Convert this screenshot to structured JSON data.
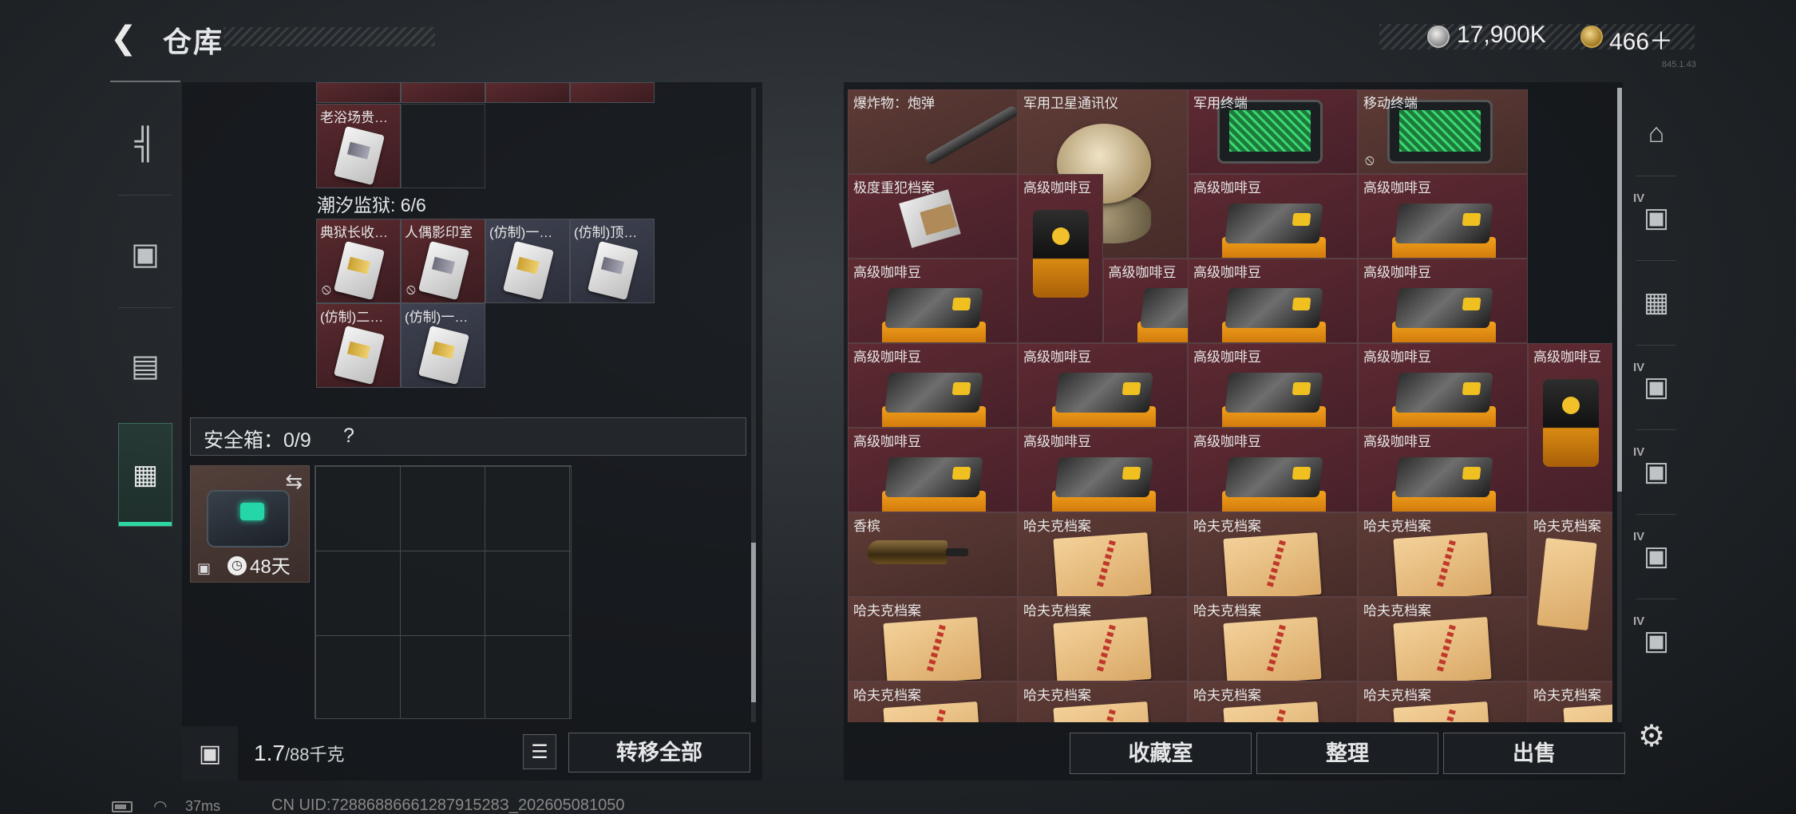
{
  "header": {
    "back_icon": "chevron-left-icon",
    "title": "仓库",
    "currency1_icon": "coin-silver-icon",
    "currency1_value": "17,900K",
    "currency2_icon": "coin-gold-icon",
    "currency2_value": "466＋",
    "version": "845.1.43"
  },
  "left_nav": {
    "items": [
      {
        "icon": "pistol-icon",
        "glyph": "╤"
      },
      {
        "icon": "backpack-icon",
        "glyph": "⌂"
      },
      {
        "icon": "vest-icon",
        "glyph": "▤"
      },
      {
        "icon": "toolbox-icon",
        "glyph": "⛶",
        "active": true
      }
    ]
  },
  "left_panel": {
    "top_item": {
      "label": "老浴场贵…"
    },
    "prison_section": {
      "title": "潮汐监狱: 6/6",
      "items": [
        {
          "label": "典狱长收…",
          "style": "red",
          "card": "gold",
          "locked": true
        },
        {
          "label": "人偶影印室",
          "style": "red",
          "card": "silver",
          "locked": true
        },
        {
          "label": "(仿制)一…",
          "style": "gray",
          "card": "gold",
          "locked": false
        },
        {
          "label": "(仿制)顶…",
          "style": "gray",
          "card": "silver",
          "locked": false
        },
        {
          "label": "(仿制)二…",
          "style": "red",
          "card": "gold",
          "locked": false
        },
        {
          "label": "(仿制)一…",
          "style": "gray",
          "card": "gold",
          "locked": false
        }
      ]
    },
    "safe": {
      "title": "安全箱：0/9",
      "help": "?",
      "duration": "48天",
      "swap_icon": "swap-icon",
      "clock_icon": "clock-icon",
      "lock_icon": "lock-icon"
    },
    "footer": {
      "lock_icon": "lock-icon",
      "weight_value": "1.7",
      "weight_unit": "/88千克",
      "list_icon": "list-icon",
      "transfer_label": "转移全部"
    }
  },
  "stash": {
    "items": [
      {
        "label": "爆炸物：炮弹",
        "type": "missile",
        "style": "tan",
        "col": 0,
        "row": 0,
        "w": 2,
        "h": 1
      },
      {
        "label": "军用卫星通讯仪",
        "type": "dish",
        "style": "tan",
        "col": 2,
        "row": 0,
        "w": 2,
        "h": 2
      },
      {
        "label": "军用终端",
        "type": "terminal",
        "style": "red",
        "col": 4,
        "row": 0,
        "w": 2,
        "h": 1
      },
      {
        "label": "移动终端",
        "type": "terminal",
        "style": "tan",
        "col": 6,
        "row": 0,
        "w": 2,
        "h": 1,
        "locked": true
      },
      {
        "label": "极度重犯档案",
        "type": "doc",
        "style": "red",
        "col": 0,
        "row": 1,
        "w": 2,
        "h": 1
      },
      {
        "label": "高级咖啡豆",
        "type": "coffee-tall",
        "style": "red",
        "col": 2,
        "row": 1,
        "w": 1,
        "h": 2
      },
      {
        "label": "高级咖啡豆",
        "type": "coffee",
        "style": "red",
        "col": 4,
        "row": 1,
        "w": 2,
        "h": 1
      },
      {
        "label": "高级咖啡豆",
        "type": "coffee",
        "style": "red",
        "col": 6,
        "row": 1,
        "w": 2,
        "h": 1
      },
      {
        "label": "高级咖啡豆",
        "type": "coffee",
        "style": "red",
        "col": 0,
        "row": 2,
        "w": 2,
        "h": 1
      },
      {
        "label": "高级咖啡豆",
        "type": "coffee",
        "style": "red",
        "col": 3,
        "row": 2,
        "w": 2,
        "h": 1
      },
      {
        "label": "高级咖啡豆",
        "type": "coffee",
        "style": "red",
        "col": 4,
        "row": 2,
        "w": 2,
        "h": 1
      },
      {
        "label": "高级咖啡豆",
        "type": "coffee",
        "style": "red",
        "col": 6,
        "row": 2,
        "w": 2,
        "h": 1
      },
      {
        "label": "高级咖啡豆",
        "type": "coffee",
        "style": "red",
        "col": 0,
        "row": 3,
        "w": 2,
        "h": 1
      },
      {
        "label": "高级咖啡豆",
        "type": "coffee",
        "style": "red",
        "col": 2,
        "row": 3,
        "w": 2,
        "h": 1
      },
      {
        "label": "高级咖啡豆",
        "type": "coffee",
        "style": "red",
        "col": 4,
        "row": 3,
        "w": 2,
        "h": 1
      },
      {
        "label": "高级咖啡豆",
        "type": "coffee",
        "style": "red",
        "col": 6,
        "row": 3,
        "w": 2,
        "h": 1
      },
      {
        "label": "高级咖啡豆",
        "type": "coffee-tall",
        "style": "red",
        "col": 8,
        "row": 3,
        "w": 1,
        "h": 2
      },
      {
        "label": "高级咖啡豆",
        "type": "coffee",
        "style": "red",
        "col": 0,
        "row": 4,
        "w": 2,
        "h": 1
      },
      {
        "label": "高级咖啡豆",
        "type": "coffee",
        "style": "red",
        "col": 2,
        "row": 4,
        "w": 2,
        "h": 1
      },
      {
        "label": "高级咖啡豆",
        "type": "coffee",
        "style": "red",
        "col": 4,
        "row": 4,
        "w": 2,
        "h": 1
      },
      {
        "label": "高级咖啡豆",
        "type": "coffee",
        "style": "red",
        "col": 6,
        "row": 4,
        "w": 2,
        "h": 1
      },
      {
        "label": "香槟",
        "type": "bottle",
        "style": "tan",
        "col": 0,
        "row": 5,
        "w": 2,
        "h": 1
      },
      {
        "label": "哈夫克档案",
        "type": "folder",
        "style": "tan",
        "col": 2,
        "row": 5,
        "w": 2,
        "h": 1
      },
      {
        "label": "哈夫克档案",
        "type": "folder",
        "style": "tan",
        "col": 4,
        "row": 5,
        "w": 2,
        "h": 1
      },
      {
        "label": "哈夫克档案",
        "type": "folder",
        "style": "tan",
        "col": 6,
        "row": 5,
        "w": 2,
        "h": 1
      },
      {
        "label": "哈夫克档案",
        "type": "folder-tall",
        "style": "tan",
        "col": 8,
        "row": 5,
        "w": 1,
        "h": 2
      },
      {
        "label": "哈夫克档案",
        "type": "folder",
        "style": "tan",
        "col": 0,
        "row": 6,
        "w": 2,
        "h": 1
      },
      {
        "label": "哈夫克档案",
        "type": "folder",
        "style": "tan",
        "col": 2,
        "row": 6,
        "w": 2,
        "h": 1
      },
      {
        "label": "哈夫克档案",
        "type": "folder",
        "style": "tan",
        "col": 4,
        "row": 6,
        "w": 2,
        "h": 1
      },
      {
        "label": "哈夫克档案",
        "type": "folder",
        "style": "tan",
        "col": 6,
        "row": 6,
        "w": 2,
        "h": 1
      },
      {
        "label": "哈夫克档案",
        "type": "folder",
        "style": "tan",
        "col": 0,
        "row": 7,
        "w": 2,
        "h": 1
      },
      {
        "label": "哈夫克档案",
        "type": "folder",
        "style": "tan",
        "col": 2,
        "row": 7,
        "w": 2,
        "h": 1
      },
      {
        "label": "哈夫克档案",
        "type": "folder",
        "style": "tan",
        "col": 4,
        "row": 7,
        "w": 2,
        "h": 1
      },
      {
        "label": "哈夫克档案",
        "type": "folder",
        "style": "tan",
        "col": 6,
        "row": 7,
        "w": 2,
        "h": 1
      },
      {
        "label": "哈夫克档案",
        "type": "folder",
        "style": "tan",
        "col": 8,
        "row": 7,
        "w": 1,
        "h": 1
      }
    ],
    "buttons": {
      "collection": "收藏室",
      "sort": "整理",
      "sell": "出售"
    }
  },
  "right_nav": {
    "items": [
      {
        "icon": "shelter-icon",
        "glyph": "⌂",
        "tier": ""
      },
      {
        "icon": "add-case-icon",
        "glyph": "▣",
        "tier": "IV"
      },
      {
        "icon": "card-edit-icon",
        "glyph": "▦",
        "tier": ""
      },
      {
        "icon": "case-filter-icon",
        "glyph": "▣",
        "tier": "IV"
      },
      {
        "icon": "case-filter-icon",
        "glyph": "▣",
        "tier": "IV"
      },
      {
        "icon": "case-key-icon",
        "glyph": "▣",
        "tier": "IV"
      },
      {
        "icon": "case-lock-icon",
        "glyph": "▣",
        "tier": "IV"
      }
    ],
    "settings_icon": "gear-icon"
  },
  "status_bar": {
    "battery_icon": "battery-icon",
    "wifi_icon": "wifi-icon",
    "ping": "37ms",
    "uid": "CN UID:7288688666128791528З_202605081050"
  }
}
